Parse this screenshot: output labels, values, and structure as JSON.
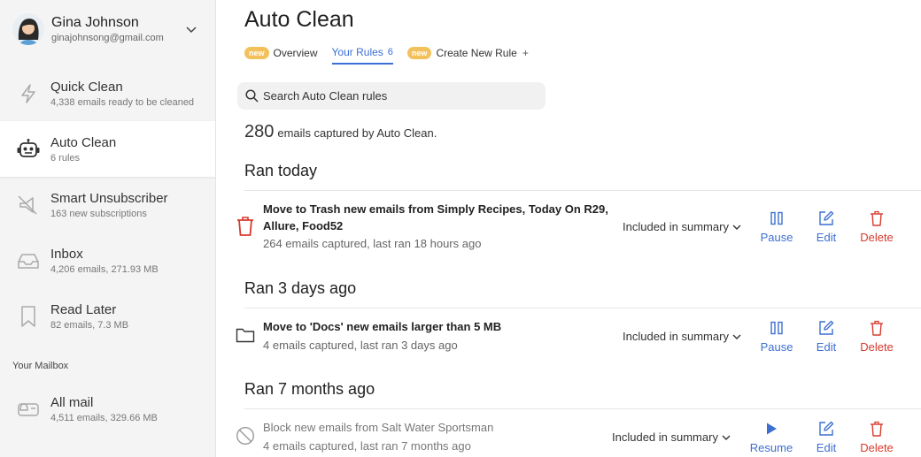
{
  "account": {
    "name": "Gina Johnson",
    "email": "ginajohnsong@gmail.com"
  },
  "sidebar": {
    "items": [
      {
        "title": "Quick Clean",
        "sub": "4,338 emails ready to be cleaned",
        "icon": "lightning-icon"
      },
      {
        "title": "Auto Clean",
        "sub": "6 rules",
        "icon": "robot-icon",
        "active": true
      },
      {
        "title": "Smart Unsubscriber",
        "sub": "163 new subscriptions",
        "icon": "unsubscribe-icon"
      },
      {
        "title": "Inbox",
        "sub": "4,206 emails, 271.93 MB",
        "icon": "inbox-icon"
      },
      {
        "title": "Read Later",
        "sub": "82 emails, 7.3 MB",
        "icon": "bookmark-icon"
      }
    ],
    "section_label": "Your Mailbox",
    "mailbox_items": [
      {
        "title": "All mail",
        "sub": "4,511 emails, 329.66 MB",
        "icon": "mailbox-icon"
      }
    ]
  },
  "main": {
    "title": "Auto Clean",
    "tabs": [
      {
        "badge": "new",
        "label": "Overview"
      },
      {
        "label": "Your Rules",
        "count": "6",
        "active": true
      },
      {
        "badge": "new",
        "label": "Create New Rule",
        "suffix": "+"
      }
    ],
    "search_placeholder": "Search Auto Clean rules",
    "captured": {
      "count": "280",
      "text": "emails captured by Auto Clean."
    },
    "groups": [
      {
        "title": "Ran today",
        "rule": {
          "title": "Move to Trash new emails from Simply Recipes, Today On R29, Allure, Food52",
          "sub": "264 emails captured, last ran 18 hours ago",
          "summary": "Included in summary",
          "primary_action": "Pause",
          "edit": "Edit",
          "delete": "Delete",
          "icon": "trash-icon"
        }
      },
      {
        "title": "Ran 3 days ago",
        "rule": {
          "title": "Move to 'Docs' new emails larger than 5 MB",
          "sub": "4 emails captured, last ran 3 days ago",
          "summary": "Included in summary",
          "primary_action": "Pause",
          "edit": "Edit",
          "delete": "Delete",
          "icon": "folder-icon"
        }
      },
      {
        "title": "Ran 7 months ago",
        "rule": {
          "title": "Block new emails from Salt Water Sportsman",
          "sub": "4 emails captured, last ran 7 months ago",
          "summary": "Included in summary",
          "primary_action": "Resume",
          "edit": "Edit",
          "delete": "Delete",
          "icon": "block-icon",
          "paused": true
        }
      }
    ]
  },
  "colors": {
    "accent": "#3d6fd1",
    "danger": "#d63a2d",
    "badge": "#f3c15b"
  }
}
